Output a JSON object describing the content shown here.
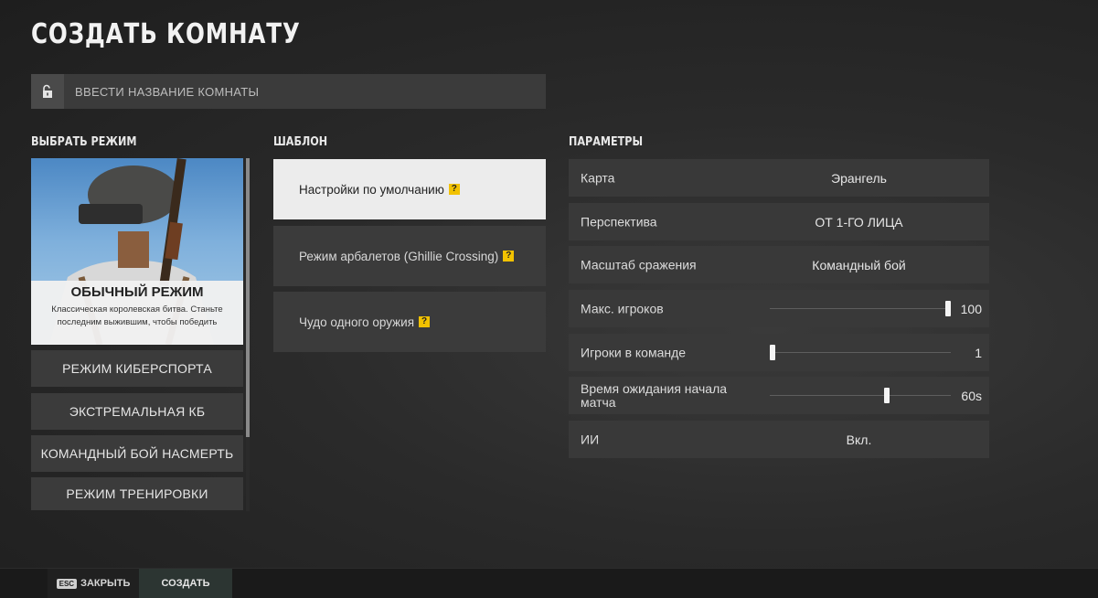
{
  "page": {
    "title": "СОЗДАТЬ КОМНАТУ"
  },
  "room_name": {
    "placeholder": "ВВЕСТИ НАЗВАНИЕ КОМНАТЫ",
    "value": ""
  },
  "mode": {
    "heading": "ВЫБРАТЬ РЕЖИМ",
    "selected": {
      "title": "ОБЫЧНЫЙ РЕЖИМ",
      "description": "Классическая королевская битва. Станьте последним выжившим, чтобы победить"
    },
    "items": [
      {
        "label": "РЕЖИМ КИБЕРСПОРТА"
      },
      {
        "label": "ЭКСТРЕМАЛЬНАЯ КБ"
      },
      {
        "label": "КОМАНДНЫЙ БОЙ НАСМЕРТЬ"
      },
      {
        "label": "РЕЖИМ ТРЕНИРОВКИ"
      }
    ],
    "scroll_fraction": 0.79
  },
  "template": {
    "heading": "ШАБЛОН",
    "items": [
      {
        "label": "Настройки по умолчанию",
        "help": "?"
      },
      {
        "label": "Режим арбалетов (Ghillie Crossing)",
        "help": "?"
      },
      {
        "label": "Чудо одного оружия",
        "help": "?"
      }
    ],
    "selected_index": 0
  },
  "params": {
    "heading": "ПАРАМЕТРЫ",
    "map": {
      "label": "Карта",
      "value": "Эрангель"
    },
    "perspective": {
      "label": "Перспектива",
      "value": "ОТ 1-ГО ЛИЦА"
    },
    "battle_scale": {
      "label": "Масштаб сражения",
      "value": "Командный бой"
    },
    "max_players": {
      "label": "Макс. игроков",
      "value": "100",
      "fraction": 1.0
    },
    "team_size": {
      "label": "Игроки в команде",
      "value": "1",
      "fraction": 0.0
    },
    "wait_time": {
      "label": "Время ожидания начала матча",
      "value": "60s",
      "fraction": 0.65
    },
    "ai": {
      "label": "ИИ",
      "value": "Вкл."
    }
  },
  "footer": {
    "esc_key": "ESC",
    "close_label": "ЗАКРЫТЬ",
    "create_label": "СОЗДАТЬ"
  },
  "colors": {
    "accent_help": "#f2c200",
    "active_template_bg": "#ececec",
    "panel_bg": "#3b3b3b"
  }
}
